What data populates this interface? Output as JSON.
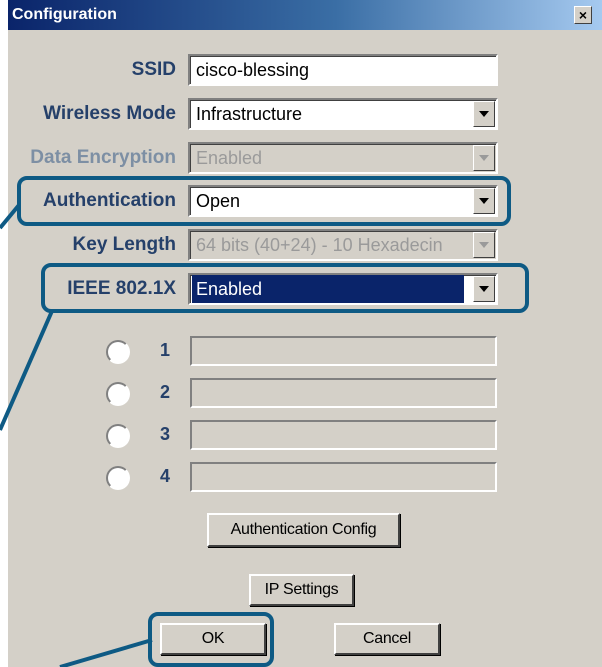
{
  "window": {
    "title": "Configuration",
    "close_glyph": "×"
  },
  "fields": {
    "ssid": {
      "label": "SSID",
      "value": "cisco-blessing"
    },
    "wireless_mode": {
      "label": "Wireless Mode",
      "value": "Infrastructure"
    },
    "data_encryption": {
      "label": "Data Encryption",
      "value": "Enabled",
      "disabled": true
    },
    "authentication": {
      "label": "Authentication",
      "value": "Open"
    },
    "key_length": {
      "label": "Key Length",
      "value": "64 bits (40+24) - 10 Hexadecin",
      "disabled": true
    },
    "ieee": {
      "label": "IEEE 802.1X",
      "value": "Enabled",
      "selected": true
    }
  },
  "keys": [
    {
      "number": "1",
      "value": ""
    },
    {
      "number": "2",
      "value": ""
    },
    {
      "number": "3",
      "value": ""
    },
    {
      "number": "4",
      "value": ""
    }
  ],
  "buttons": {
    "auth_config": "Authentication Config",
    "ip_settings": "IP Settings",
    "ok": "OK",
    "cancel": "Cancel"
  },
  "icons": {
    "dropdown": "chevron-down-icon",
    "close": "close-icon"
  },
  "colors": {
    "highlight": "#0e5a84",
    "label": "#25406a",
    "title_bar": "#0a246a",
    "selection": "#0a246a"
  }
}
